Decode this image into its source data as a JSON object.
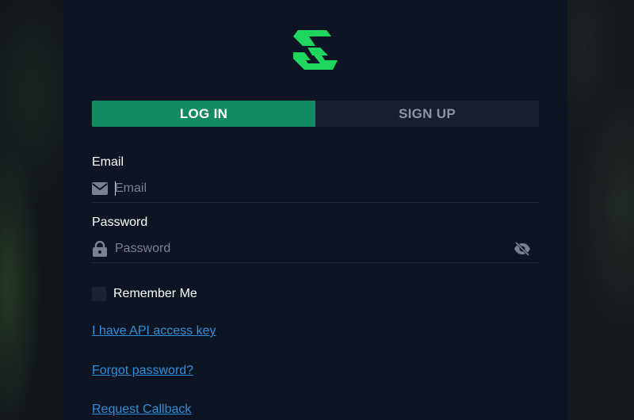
{
  "tabs": {
    "login": "LOG IN",
    "signup": "SIGN UP",
    "active": "login"
  },
  "email": {
    "label": "Email",
    "placeholder": "Email",
    "value": "",
    "icon": "envelope-icon"
  },
  "password": {
    "label": "Password",
    "placeholder": "Password",
    "value": "",
    "icon": "lock-icon",
    "toggle_icon": "eye-off-icon"
  },
  "remember": {
    "label": "Remember Me",
    "checked": false
  },
  "links": {
    "api_key": "I have API access key",
    "forgot": "Forgot password?",
    "callback": "Request Callback"
  },
  "colors": {
    "accent": "#128a62",
    "logo": "#1fd65f",
    "panel": "#0d1423",
    "link": "#2f8fd8"
  }
}
